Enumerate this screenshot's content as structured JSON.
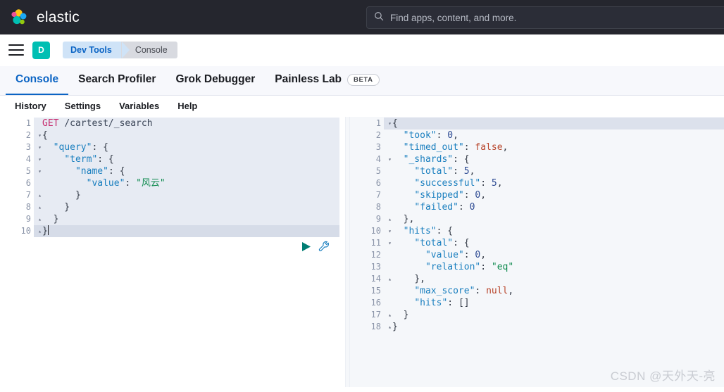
{
  "header": {
    "brand_name": "elastic",
    "logo_icon": "elastic-logo-icon",
    "search": {
      "icon": "search-icon",
      "placeholder": "Find apps, content, and more.",
      "value": ""
    }
  },
  "nav": {
    "menu_icon": "hamburger-menu-icon",
    "space_avatar_letter": "D",
    "breadcrumbs": [
      {
        "label": "Dev Tools"
      },
      {
        "label": "Console"
      }
    ]
  },
  "tabs": [
    {
      "label": "Console",
      "active": true,
      "badge": ""
    },
    {
      "label": "Search Profiler",
      "active": false,
      "badge": ""
    },
    {
      "label": "Grok Debugger",
      "active": false,
      "badge": ""
    },
    {
      "label": "Painless Lab",
      "active": false,
      "badge": "BETA"
    }
  ],
  "console_menu": [
    {
      "label": "History"
    },
    {
      "label": "Settings"
    },
    {
      "label": "Variables"
    },
    {
      "label": "Help"
    }
  ],
  "request_editor": {
    "actions": {
      "send_icon": "play-icon",
      "wrench_icon": "wrench-icon"
    },
    "line_numbers": [
      "1",
      "2",
      "3",
      "4",
      "5",
      "6",
      "7",
      "8",
      "9",
      "10"
    ],
    "folds": [
      "",
      "down",
      "down",
      "down",
      "down",
      "",
      "up",
      "up",
      "up",
      "up"
    ],
    "lines": [
      "GET /cartest/_search",
      "{",
      "  \"query\": {",
      "    \"term\": {",
      "      \"name\": {",
      "        \"value\": \"风云\"",
      "      }",
      "    }",
      "  }",
      "}"
    ],
    "method": "GET",
    "path": "/cartest/_search",
    "query_field": "name",
    "query_value": "风云",
    "cursor_line": 10
  },
  "response_editor": {
    "line_numbers": [
      "1",
      "2",
      "3",
      "4",
      "5",
      "6",
      "7",
      "8",
      "9",
      "10",
      "11",
      "12",
      "13",
      "14",
      "15",
      "16",
      "17",
      "18"
    ],
    "folds": [
      "down",
      "",
      "",
      "down",
      "",
      "",
      "",
      "",
      "up",
      "down",
      "down",
      "",
      "",
      "up",
      "",
      "",
      "up",
      "up"
    ],
    "lines": [
      "{",
      "  \"took\": 0,",
      "  \"timed_out\": false,",
      "  \"_shards\": {",
      "    \"total\": 5,",
      "    \"successful\": 5,",
      "    \"skipped\": 0,",
      "    \"failed\": 0",
      "  },",
      "  \"hits\": {",
      "    \"total\": {",
      "      \"value\": 0,",
      "      \"relation\": \"eq\"",
      "    },",
      "    \"max_score\": null,",
      "    \"hits\": []",
      "  }",
      "}"
    ],
    "values": {
      "took": "0",
      "timed_out": "false",
      "shards_total": "5",
      "shards_successful": "5",
      "shards_skipped": "0",
      "shards_failed": "0",
      "hits_total_value": "0",
      "hits_total_relation": "eq",
      "max_score": "null",
      "hits": "[]"
    }
  },
  "watermark": {
    "text": "CSDN @天外天-亮"
  },
  "colors": {
    "header_bg": "#25262e",
    "accent_blue": "#0b64c4",
    "space_teal": "#00bfb3",
    "crumb_active_bg": "#cfe3f7",
    "crumb_inactive_bg": "#d8dae0",
    "editor_selection": "#e7ebf3",
    "active_line": "#d6dce8",
    "string_green": "#0e8a4e",
    "method_pink": "#c62a6d",
    "key_blue": "#1a7fbf",
    "bool_red": "#b8452b"
  }
}
